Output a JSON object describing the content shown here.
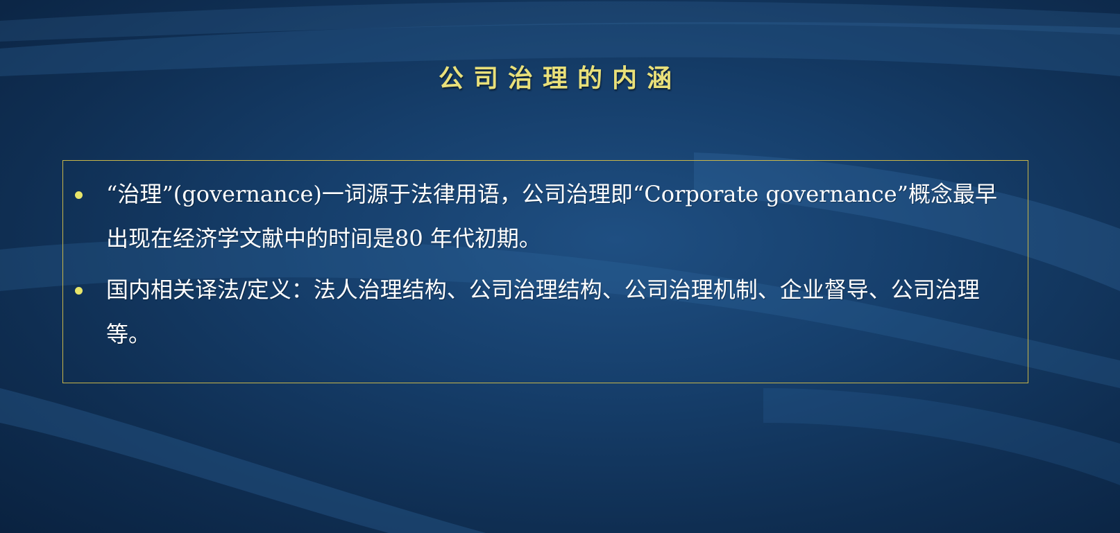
{
  "slide": {
    "title": "公司治理的内涵",
    "bullets": [
      {
        "text": "“治理”(governance)一词源于法律用语，公司治理即“Corporate governance”概念最早出现在经济学文献中的时间是80 年代初期。"
      },
      {
        "text": "国内相关译法/定义：法人治理结构、公司治理结构、公司治理机制、企业督导、公司治理等。"
      }
    ]
  },
  "colors": {
    "title": "#e9e07a",
    "bullet": "#e8e56a",
    "box_border": "#c8b64a",
    "text": "#ffffff",
    "background": "#163f6c"
  }
}
